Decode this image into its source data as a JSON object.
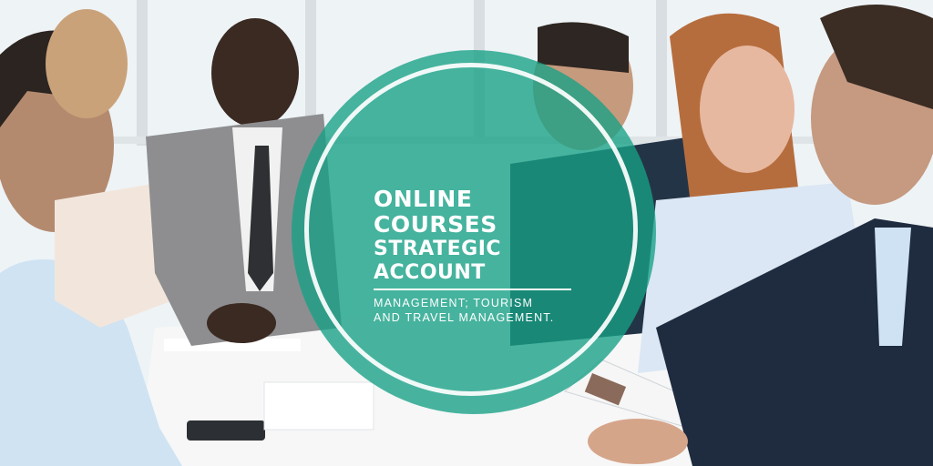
{
  "badge": {
    "title_line1": "ONLINE COURSES",
    "title_line2": "STRATEGIC ACCOUNT",
    "subtitle_line1": "MANAGEMENT; TOURISM",
    "subtitle_line2": "AND TRAVEL MANAGEMENT."
  },
  "colors": {
    "badge": "#16a085",
    "ring": "#ffffff",
    "text": "#ffffff"
  }
}
